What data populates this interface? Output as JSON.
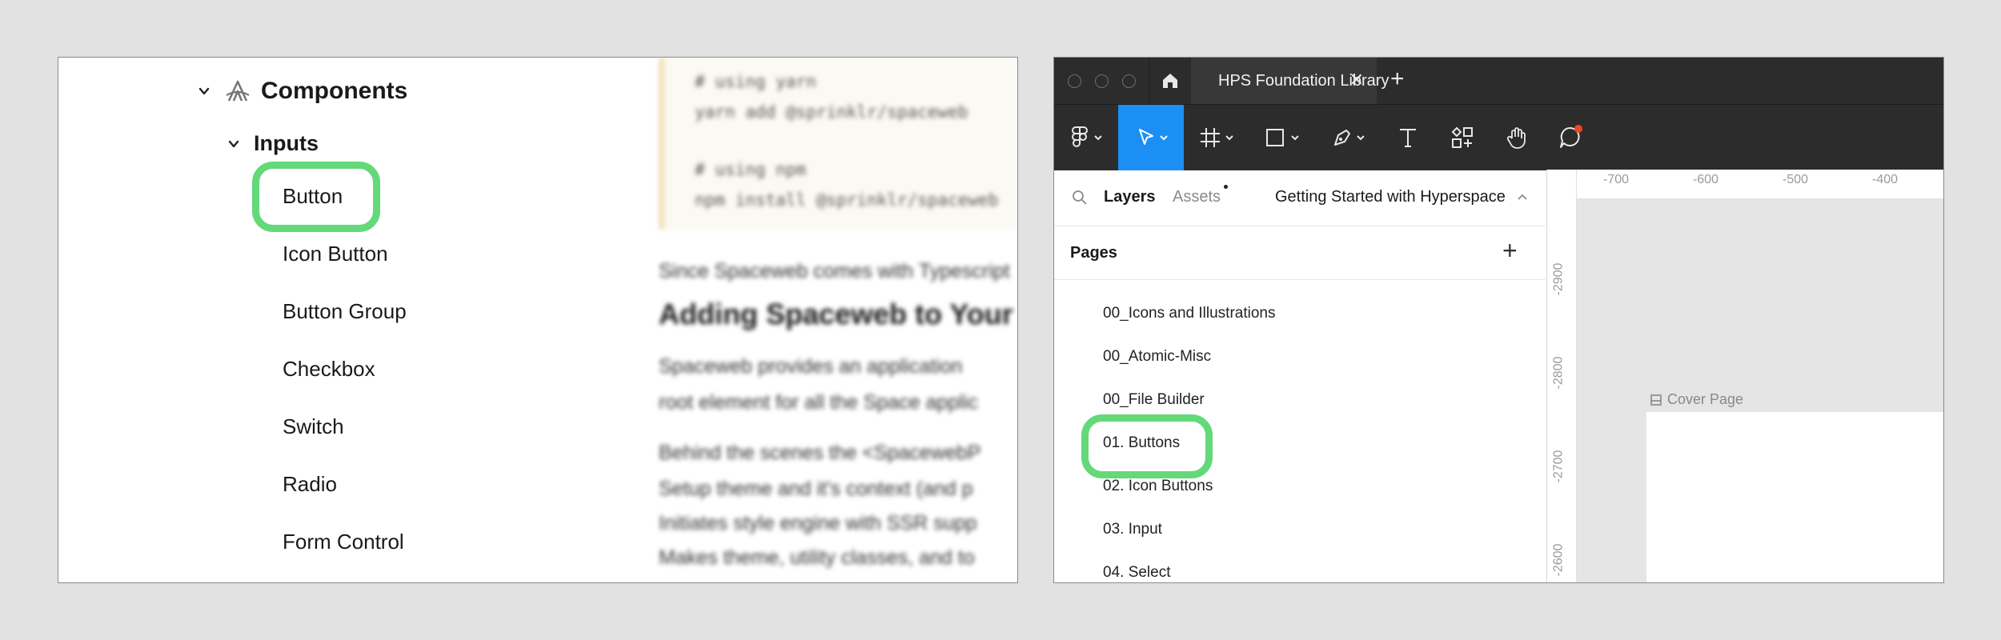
{
  "docs_nav": {
    "section_title": "Components",
    "group_title": "Inputs",
    "items": [
      "Button",
      "Icon Button",
      "Button Group",
      "Checkbox",
      "Switch",
      "Radio",
      "Form Control"
    ]
  },
  "docs_content": {
    "code_lines": [
      "# using yarn",
      "yarn add @sprinklr/spaceweb",
      "",
      "# using npm",
      "npm install @sprinklr/spaceweb"
    ],
    "intro_text": "Since Spaceweb comes with Typescript",
    "heading": "Adding Spaceweb to Your",
    "paragraph_lines": [
      "Spaceweb provides an application",
      "root element for all the Space applic",
      "Behind the scenes the <SpacewebP",
      "Setup theme and it's context (and p",
      "Initiates style engine with SSR supp",
      "Makes theme, utility classes, and to"
    ]
  },
  "app": {
    "tab_title": "HPS Foundation Library",
    "layers_tab": "Layers",
    "assets_tab": "Assets",
    "page_selector": "Getting Started with Hyperspace",
    "pages_title": "Pages",
    "pages": [
      "00_Icons and Illustrations",
      "00_Atomic-Misc",
      "00_File Builder",
      "01. Buttons",
      "02. Icon Buttons",
      "03. Input",
      "04. Select"
    ],
    "ruler_x": [
      "-700",
      "-600",
      "-500",
      "-400"
    ],
    "ruler_y": [
      "-2900",
      "-2800",
      "-2700",
      "-2600"
    ],
    "frame_label": "Cover Page"
  },
  "colors": {
    "highlight": "#63d97a",
    "active_tool": "#1b8ff3",
    "notification_dot": "#f24822",
    "toolbar_bg": "#2c2c2c"
  }
}
